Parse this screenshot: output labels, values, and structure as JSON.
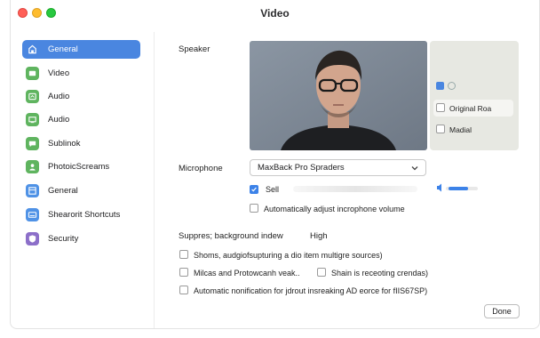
{
  "window": {
    "title": "Video"
  },
  "sidebar": {
    "items": [
      {
        "label": "General",
        "icon": "home-icon",
        "color": "#ffffff",
        "active": true
      },
      {
        "label": "Video",
        "icon": "video-icon",
        "color": "#5fb45f",
        "active": false
      },
      {
        "label": "Audio",
        "icon": "headphones-icon",
        "color": "#5fb45f",
        "active": false
      },
      {
        "label": "Audio",
        "icon": "screen-icon",
        "color": "#5fb45f",
        "active": false
      },
      {
        "label": "Sublinok",
        "icon": "chat-icon",
        "color": "#5fb45f",
        "active": false
      },
      {
        "label": "PhotoicScreams",
        "icon": "person-icon",
        "color": "#5fb45f",
        "active": false
      },
      {
        "label": "General",
        "icon": "grid-icon",
        "color": "#4f92e6",
        "active": false
      },
      {
        "label": "Shearorit Shortcuts",
        "icon": "keyboard-icon",
        "color": "#4f92e6",
        "active": false
      },
      {
        "label": "Security",
        "icon": "shield-icon",
        "color": "#8c6fc9",
        "active": false
      }
    ]
  },
  "speaker": {
    "label": "Speaker",
    "panel": {
      "options": [
        {
          "label": "Original Roa",
          "checked": false
        },
        {
          "label": "Madial",
          "checked": false
        }
      ]
    }
  },
  "microphone": {
    "label": "Microphone",
    "selected": "MaxBack Pro Spraders",
    "sell_label": "Sell",
    "sell_checked": true,
    "auto_adjust": "Automatically adjust incrophone volume",
    "auto_adjust_checked": false
  },
  "suppress": {
    "label": "Suppres; background indew",
    "level": "High"
  },
  "options": {
    "opt1": "Shoms, audgiofsupturing a dio item multigre sources)",
    "opt2": "Milcas and Protowcanh veak..",
    "opt3": "Shain is receoting crendas)",
    "opt4": "Automatic nonification for jdrout insreaking AD eorce for fIIS67SP)"
  },
  "done_label": "Done",
  "colors": {
    "accent": "#4a86e0",
    "checkbox_accent": "#3c82e8"
  }
}
